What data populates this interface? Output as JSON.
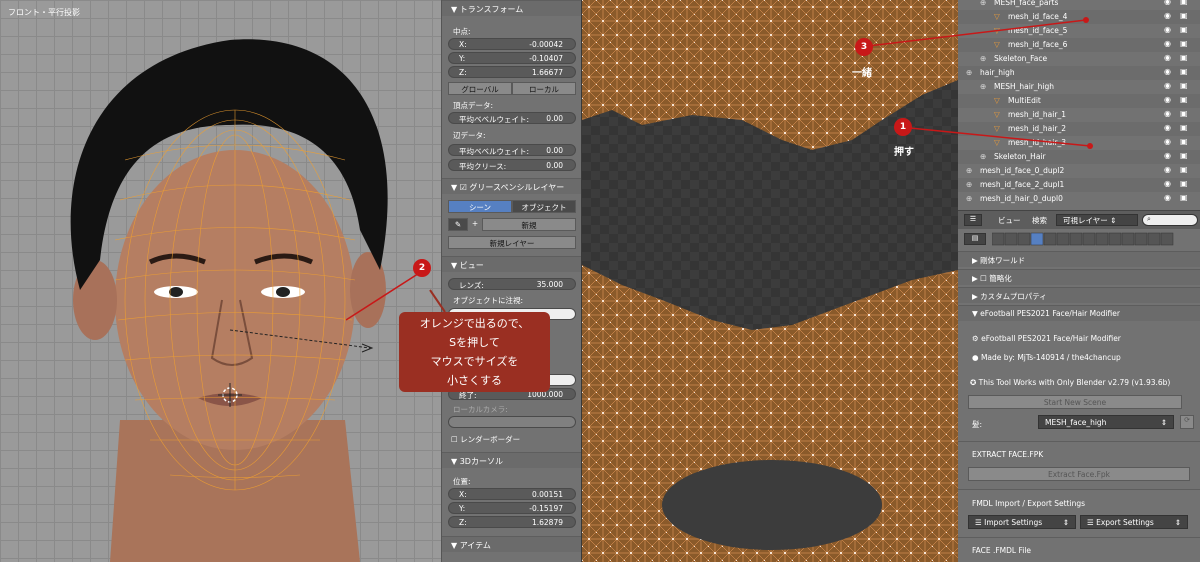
{
  "viewport": {
    "label": "フロント・平行投影"
  },
  "npanel": {
    "transform": {
      "title": "トランスフォーム",
      "median": "中点:",
      "x_label": "X:",
      "x": "-0.00042",
      "y_label": "Y:",
      "y": "-0.10407",
      "z_label": "Z:",
      "z": "1.66677",
      "global": "グローバル",
      "local": "ローカル"
    },
    "vertex_data": "頂点データ:",
    "vertex_bevel": "平均ベベルウェイト:",
    "vertex_bevel_val": "0.00",
    "edge_data": "辺データ:",
    "edge_bevel": "平均ベベルウェイト:",
    "edge_bevel_val": "0.00",
    "edge_crease": "平均クリース:",
    "edge_crease_val": "0.00",
    "grease": {
      "title": "グリースペンシルレイヤー",
      "scene": "シーン",
      "object": "オブジェクト",
      "new": "新規",
      "new_layer": "新規レイヤー"
    },
    "view": {
      "title": "ビュー",
      "lens": "レンズ:",
      "lens_val": "35.000",
      "lock": "オブジェクトに注視:",
      "end_label": "終了:",
      "end_val": "1000.000",
      "local_cam": "ローカルカメラ:",
      "render_border": "レンダーボーダー"
    },
    "cursor": {
      "title": "3Dカーソル",
      "pos": "位置:",
      "x_label": "X:",
      "x": "0.00151",
      "y_label": "Y:",
      "y": "-0.15197",
      "z_label": "Z:",
      "z": "1.62879"
    },
    "item": {
      "title": "アイテム"
    }
  },
  "outliner": {
    "rows": [
      {
        "name": "MESH_face_parts",
        "indent": 1
      },
      {
        "name": "mesh_id_face_4",
        "indent": 2
      },
      {
        "name": "mesh_id_face_5",
        "indent": 2
      },
      {
        "name": "mesh_id_face_6",
        "indent": 2
      },
      {
        "name": "Skeleton_Face",
        "indent": 1
      },
      {
        "name": "hair_high",
        "indent": 0
      },
      {
        "name": "MESH_hair_high",
        "indent": 1
      },
      {
        "name": "MultiEdit",
        "indent": 2
      },
      {
        "name": "mesh_id_hair_1",
        "indent": 2
      },
      {
        "name": "mesh_id_hair_2",
        "indent": 2
      },
      {
        "name": "mesh_id_hair_3",
        "indent": 2
      },
      {
        "name": "Skeleton_Hair",
        "indent": 1
      },
      {
        "name": "mesh_id_face_0_dupl2",
        "indent": 0
      },
      {
        "name": "mesh_id_face_2_dupl1",
        "indent": 0
      },
      {
        "name": "mesh_id_hair_0_dupl0",
        "indent": 0
      }
    ],
    "header": {
      "view": "ビュー",
      "search": "検索",
      "layer_select": "可視レイヤー"
    }
  },
  "props": {
    "rigid_world": "剛体ワールド",
    "simplify": "簡略化",
    "custom_props": "カスタムプロパティ",
    "addon_title": "eFootball PES2021 Face/Hair Modifier",
    "addon_name": "eFootball PES2021 Face/Hair Modifier",
    "made_by": "Made by: MjTs-140914 / the4chancup",
    "works_with": "This Tool Works with Only Blender v2.79 (v1.93.6b)",
    "start_scene": "Start New Scene",
    "hair_label": "髪:",
    "hair_value": "MESH_face_high",
    "extract_title": "EXTRACT FACE.FPK",
    "extract_btn": "Extract Face.Fpk",
    "fmdl_title": "FMDL Import / Export Settings",
    "import_settings": "Import Settings",
    "export_settings": "Export Settings",
    "face_fmdl": "FACE .FMDL File"
  },
  "annotations": {
    "b1": "1",
    "b1_text": "押す",
    "b2": "2",
    "b3": "3",
    "b3_text": "一緒",
    "callout": [
      "オレンジで出るので、",
      "Sを押して",
      "マウスでサイズを",
      "小さくする"
    ]
  },
  "colors": {
    "accent": "#5680c2",
    "annotation": "#c81818",
    "wire": "#f0a030"
  }
}
